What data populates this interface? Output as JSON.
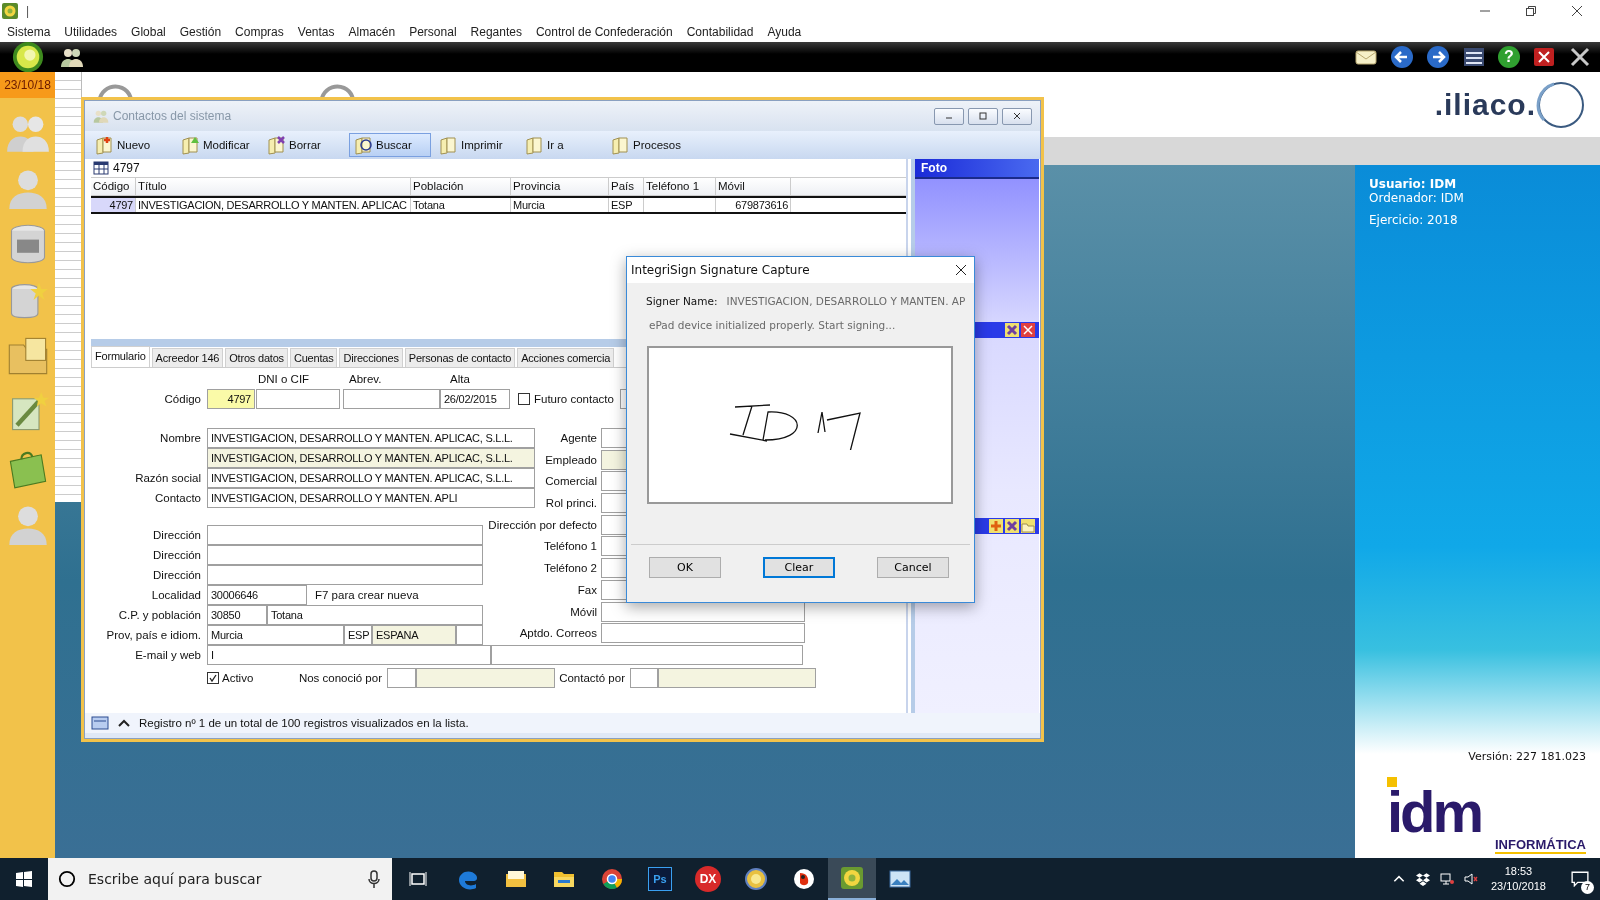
{
  "title_bar": {
    "text": "|"
  },
  "menu": [
    "Sistema",
    "Utilidades",
    "Global",
    "Gestión",
    "Compras",
    "Ventas",
    "Almacén",
    "Personal",
    "Regantes",
    "Control de Confederación",
    "Contabilidad",
    "Ayuda"
  ],
  "app_toolbar": {
    "help_glyph": "?"
  },
  "date_badge": "23/10/18",
  "top_logo": ".iliaco.",
  "contacts_window": {
    "title": "Contactos del sistema",
    "toolbar": [
      {
        "label": "Nuevo",
        "selected": false
      },
      {
        "label": "Modificar",
        "selected": false
      },
      {
        "label": "Borrar",
        "selected": false
      },
      {
        "label": "Buscar",
        "selected": true
      },
      {
        "label": "Imprimir",
        "selected": false
      },
      {
        "label": "Ir a",
        "selected": false
      },
      {
        "label": "Procesos",
        "selected": false
      }
    ],
    "search_value": "4797",
    "table": {
      "columns": [
        "Código",
        "Título",
        "Población",
        "Provincia",
        "País",
        "Teléfono 1",
        "Móvil"
      ],
      "rows": [
        {
          "selected": true,
          "cells": [
            "4797",
            "INVESTIGACION, DESARROLLO Y MANTEN. APLICAC",
            "Totana",
            "Murcia",
            "ESP",
            "",
            "679873616"
          ]
        }
      ]
    },
    "tabs": [
      {
        "label": "Formulario",
        "selected": true
      },
      {
        "label": "Acreedor 146",
        "selected": false
      },
      {
        "label": "Otros datos",
        "selected": false
      },
      {
        "label": "Cuentas",
        "selected": false
      },
      {
        "label": "Direcciones",
        "selected": false
      },
      {
        "label": "Personas de contacto",
        "selected": false
      },
      {
        "label": "Acciones comercia",
        "selected": false
      }
    ],
    "form": {
      "header_labels": [
        "DNI o CIF",
        "Abrev.",
        "Alta"
      ],
      "codigo": {
        "label": "Código",
        "fields": [
          {
            "value": "4797",
            "kind": "key"
          },
          {
            "kind": "text"
          },
          {
            "kind": "text"
          },
          {
            "value": "26/02/2015",
            "kind": "text"
          }
        ]
      },
      "futuro_contacto": {
        "label": "Futuro contacto",
        "checked": false
      },
      "name_rows": [
        {
          "label": "Nombre",
          "value": "INVESTIGACION, DESARROLLO Y MANTEN. APLICAC, S.L.L.",
          "kind": "text"
        },
        {
          "value": "INVESTIGACION, DESARROLLO Y MANTEN. APLICAC, S.L.L.",
          "kind": "readonly"
        },
        {
          "label": "Razón social",
          "value": "INVESTIGACION, DESARROLLO Y MANTEN. APLICAC, S.L.L.",
          "kind": "text"
        },
        {
          "label": "Contacto",
          "value": "INVESTIGACION, DESARROLLO Y MANTEN. APLI",
          "kind": "text"
        }
      ],
      "address_rows": [
        {
          "label": "Dirección",
          "fields": [
            {
              "kind": "text"
            }
          ]
        },
        {
          "label": "Dirección",
          "fields": [
            {
              "kind": "text"
            }
          ]
        },
        {
          "label": "Dirección",
          "fields": [
            {
              "kind": "text"
            }
          ]
        },
        {
          "label": "Localidad",
          "fields": [
            {
              "value": "30006646",
              "kind": "text"
            }
          ],
          "hint": "F7 para crear nueva"
        },
        {
          "label": "C.P. y población",
          "fields": [
            {
              "value": "30850",
              "kind": "text"
            },
            {
              "value": "Totana",
              "kind": "text"
            }
          ]
        },
        {
          "label": "Prov, país e idiom.",
          "fields": [
            {
              "value": "Murcia",
              "kind": "text"
            },
            {
              "value": "ESP",
              "kind": "text"
            },
            {
              "value": "ESPANA",
              "kind": "readonly"
            },
            {
              "kind": "text"
            }
          ]
        }
      ],
      "right_rows": [
        {
          "label": "Agente",
          "kind": "text"
        },
        {
          "label": "Empleado",
          "kind": "readonly"
        },
        {
          "label": "Comercial",
          "kind": "text"
        },
        {
          "label": "Rol princi.",
          "kind": "text"
        },
        {
          "label": "Dirección por defecto",
          "kind": "text"
        },
        {
          "label": "Teléfono 1",
          "kind": "text"
        },
        {
          "label": "Teléfono 2",
          "kind": "text"
        },
        {
          "label": "Fax",
          "kind": "text"
        },
        {
          "label": "Móvil",
          "kind": "text"
        },
        {
          "label": "Aptdo. Correos",
          "kind": "text"
        }
      ],
      "email": {
        "label": "E-mail y web",
        "value": "I"
      },
      "activo": {
        "label": "Activo",
        "checked": true
      },
      "nos_conocio": {
        "label": "Nos conoció por",
        "fields": [
          {
            "kind": "text"
          },
          {
            "kind": "readonly"
          }
        ]
      },
      "contacto_por": {
        "label": "Contactó por",
        "fields": [
          {
            "kind": "text"
          },
          {
            "kind": "readonly"
          }
        ]
      }
    },
    "status": "Registro nº 1 de un total de 100 registros visualizados en la lista.",
    "photo_panel": {
      "title": "Foto"
    }
  },
  "signature_dialog": {
    "title": "IntegriSign Signature Capture",
    "signer_label": "Signer Name:",
    "signer_name": "INVESTIGACION, DESARROLLO Y MANTEN. AP",
    "message": "ePad device initialized properly. Start signing...",
    "buttons": [
      {
        "label": "OK",
        "focused": false
      },
      {
        "label": "Clear",
        "focused": true
      },
      {
        "label": "Cancel",
        "focused": false
      }
    ]
  },
  "info_panel": {
    "user": "Usuario: IDM",
    "computer": "Ordenador: IDM",
    "year": "Ejercicio: 2018",
    "version": "Versión: 227 181.023",
    "logo_main": "idm",
    "logo_sub": "INFORMÁTICA"
  },
  "taskbar": {
    "search_placeholder": "Escribe aquí para buscar",
    "apps": [
      {
        "kind": "edge",
        "active": false
      },
      {
        "kind": "mail",
        "active": false
      },
      {
        "kind": "folder",
        "active": false
      },
      {
        "kind": "chrome",
        "active": false
      },
      {
        "kind": "ps",
        "label": "Ps",
        "active": false
      },
      {
        "kind": "dx",
        "label": "DX",
        "active": false
      },
      {
        "kind": "coin",
        "active": false
      },
      {
        "kind": "bird",
        "active": false
      },
      {
        "kind": "gapp",
        "active": true
      },
      {
        "kind": "picture",
        "active": false
      }
    ],
    "time": "18:53",
    "date": "23/10/2018",
    "notifications": "7"
  }
}
